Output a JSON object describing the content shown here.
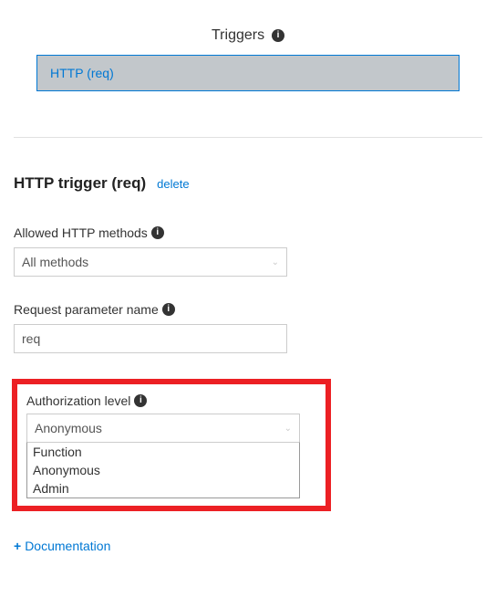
{
  "triggers": {
    "title": "Triggers",
    "items": [
      "HTTP (req)"
    ]
  },
  "detail": {
    "title": "HTTP trigger (req)",
    "delete_label": "delete",
    "allowed_methods": {
      "label": "Allowed HTTP methods",
      "value": "All methods"
    },
    "param_name": {
      "label": "Request parameter name",
      "value": "req"
    },
    "auth_level": {
      "label": "Authorization level",
      "value": "Anonymous",
      "options": [
        "Function",
        "Anonymous",
        "Admin"
      ]
    }
  },
  "doc_link": "Documentation"
}
